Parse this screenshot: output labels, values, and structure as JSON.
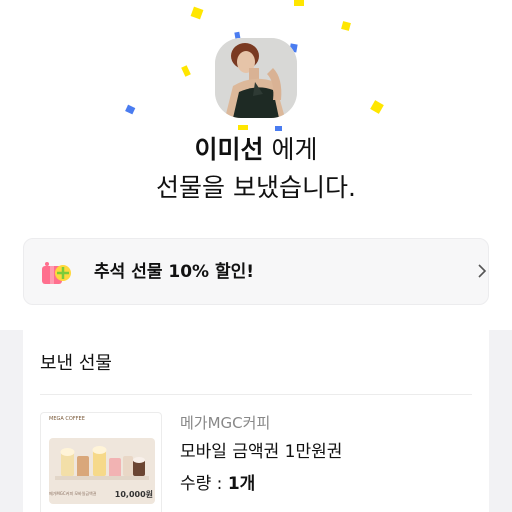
{
  "recipient": {
    "name": "이미선",
    "suffix": " 에게",
    "message": "선물을 보냈습니다."
  },
  "promo": {
    "text": "추석 선물 10% 할인!",
    "icon": "gift-sparkle-icon"
  },
  "sent_gifts": {
    "title": "보낸 선물",
    "item": {
      "brand": "메가MGC커피",
      "product": "모바일 금액권 1만원권",
      "quantity_label": "수량 : ",
      "quantity_value": "1개",
      "thumbnail": {
        "brand": "MEGA COFFEE",
        "desc": "메가MGC커피 모바일금액권",
        "amount": "10,000원"
      }
    }
  },
  "colors": {
    "highlight": "#ffe600",
    "confetti_yellow": "#ffe600",
    "confetti_blue": "#4a7cf0"
  }
}
